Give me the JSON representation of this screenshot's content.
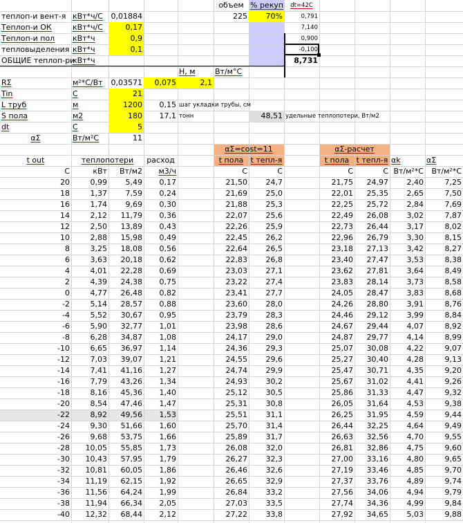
{
  "colors": {
    "yellow": "#ffff00",
    "lavender": "#ccccff",
    "orange": "#f4b183",
    "rowHighlight": "#e6e6e6",
    "gridline": "#d4d4d4",
    "darkLine": "#000000",
    "selection": "#000000"
  },
  "params": [
    {
      "label": "теплоп-и вент-я",
      "unit": "кВт*ч/С",
      "value": "0,01884",
      "value_bg": "none",
      "label_u": false
    },
    {
      "label": "Теплоп-и ОК",
      "unit": "кВт*ч/С",
      "value": "0,17",
      "value_bg": "yellow",
      "label_u": true
    },
    {
      "label": "Теплоп-и пол",
      "unit": "кВт*ч",
      "value": "0,9",
      "value_bg": "yellow",
      "label_u": true
    },
    {
      "label": "тепловыделения",
      "unit": "кВт*ч",
      "value": "0,1",
      "value_bg": "yellow",
      "label_u": false
    },
    {
      "label": "ОБЩИЕ теплоп-ри",
      "unit": "кВт*ч",
      "value": "",
      "value_bg": "none",
      "label_u": false
    }
  ],
  "volume": {
    "header": "объем",
    "value": "225"
  },
  "recup": {
    "header": "% рекуп",
    "value": "70%"
  },
  "dt_col": {
    "header": "dt=42C",
    "values": [
      "0,791",
      "7,140",
      "0,900",
      "-0,100",
      "8,731"
    ]
  },
  "h_header": "Н, м",
  "k_header": "Вт/м°С",
  "rsigma": {
    "label": "RΣ",
    "unit": "м²*С/Вт",
    "value": "0,03571",
    "h": "0,075",
    "k": "2,1"
  },
  "tin": {
    "label": "Tin",
    "unit": "С",
    "value": "21"
  },
  "ltrub": {
    "label": "L труб",
    "unit": "м",
    "value": "1200",
    "step": "0,15",
    "step_label": "шаг укладки трубы, см"
  },
  "spola": {
    "label": "S пола",
    "unit": "м2",
    "value": "180",
    "tons": "17,1",
    "tons_label": "тонн",
    "specific": "48,51",
    "specific_label": "удельные теплопотери, Вт/м2"
  },
  "dt": {
    "label": "dt",
    "unit": "С",
    "value": "5"
  },
  "asigma": {
    "label": "αΣ",
    "unit": "Вт/м²С",
    "value": "11"
  },
  "block1_title": "αΣ=cost=11",
  "block2_title": "αΣ-расчет",
  "headers": {
    "tout": "t out",
    "teplopoteri": "теплопотери",
    "rashod": "расход",
    "tpola": "t пола",
    "ttepl": "t тепл-я",
    "ak": "αk",
    "asig": "αΣ"
  },
  "units": [
    "С",
    "кВт",
    "Вт/м2",
    "м3/ч",
    "С",
    "С",
    "С",
    "С",
    "Вт/м²*С",
    "Вт/м²*С"
  ],
  "highlight_row": 21,
  "rows": [
    [
      "20",
      "0,99",
      "5,49",
      "0,17",
      "21,50",
      "24,7",
      "21,75",
      "24,97",
      "2,40",
      "7,25"
    ],
    [
      "18",
      "1,37",
      "7,59",
      "0,24",
      "21,69",
      "25,0",
      "22,01",
      "25,35",
      "2,65",
      "7,50"
    ],
    [
      "16",
      "1,74",
      "9,69",
      "0,30",
      "21,88",
      "25,3",
      "22,25",
      "25,72",
      "2,84",
      "7,69"
    ],
    [
      "14",
      "2,12",
      "11,79",
      "0,36",
      "22,07",
      "25,6",
      "22,49",
      "26,08",
      "3,02",
      "7,87"
    ],
    [
      "12",
      "2,50",
      "13,89",
      "0,43",
      "22,26",
      "25,9",
      "22,73",
      "26,44",
      "3,17",
      "8,02"
    ],
    [
      "10",
      "2,88",
      "15,98",
      "0,49",
      "22,45",
      "26,2",
      "22,96",
      "26,79",
      "3,30",
      "8,15"
    ],
    [
      "8",
      "3,25",
      "18,08",
      "0,56",
      "22,64",
      "26,5",
      "23,18",
      "27,13",
      "3,42",
      "8,27"
    ],
    [
      "6",
      "3,63",
      "20,18",
      "0,62",
      "22,83",
      "26,8",
      "23,40",
      "27,47",
      "3,53",
      "8,38"
    ],
    [
      "4",
      "4,01",
      "22,28",
      "0,69",
      "23,03",
      "27,1",
      "23,62",
      "27,81",
      "3,64",
      "8,49"
    ],
    [
      "2",
      "4,39",
      "24,38",
      "0,75",
      "23,22",
      "27,4",
      "23,83",
      "28,14",
      "3,73",
      "8,58"
    ],
    [
      "0",
      "4,77",
      "26,48",
      "0,82",
      "23,41",
      "27,7",
      "24,05",
      "28,47",
      "3,83",
      "8,68"
    ],
    [
      "-2",
      "5,14",
      "28,57",
      "0,88",
      "23,60",
      "28,0",
      "24,26",
      "28,80",
      "3,91",
      "8,76"
    ],
    [
      "-4",
      "5,52",
      "30,67",
      "0,95",
      "23,79",
      "28,3",
      "24,46",
      "29,12",
      "3,99",
      "8,84"
    ],
    [
      "-6",
      "5,90",
      "32,77",
      "1,01",
      "23,98",
      "28,6",
      "24,67",
      "29,44",
      "4,07",
      "8,92"
    ],
    [
      "-8",
      "6,28",
      "34,87",
      "1,08",
      "24,17",
      "29,0",
      "24,87",
      "29,77",
      "4,14",
      "8,99"
    ],
    [
      "-10",
      "6,65",
      "36,97",
      "1,14",
      "24,36",
      "29,3",
      "25,07",
      "30,08",
      "4,22",
      "9,07"
    ],
    [
      "-12",
      "7,03",
      "39,07",
      "1,21",
      "24,55",
      "29,6",
      "25,27",
      "30,40",
      "4,28",
      "9,13"
    ],
    [
      "-14",
      "7,41",
      "41,16",
      "1,27",
      "24,74",
      "29,9",
      "25,47",
      "30,71",
      "4,35",
      "9,20"
    ],
    [
      "-16",
      "7,79",
      "43,26",
      "1,34",
      "24,93",
      "30,2",
      "25,67",
      "31,02",
      "4,41",
      "9,26"
    ],
    [
      "-18",
      "8,16",
      "45,36",
      "1,40",
      "25,12",
      "30,5",
      "25,86",
      "31,33",
      "4,47",
      "9,32"
    ],
    [
      "-20",
      "8,54",
      "47,46",
      "1,47",
      "25,31",
      "30,8",
      "26,05",
      "31,64",
      "4,53",
      "9,38"
    ],
    [
      "-22",
      "8,92",
      "49,56",
      "1,53",
      "25,51",
      "31,1",
      "26,25",
      "31,95",
      "4,59",
      "9,44"
    ],
    [
      "-24",
      "9,30",
      "51,66",
      "1,60",
      "25,70",
      "31,4",
      "26,44",
      "32,25",
      "4,64",
      "9,49"
    ],
    [
      "-26",
      "9,68",
      "53,75",
      "1,66",
      "25,89",
      "31,7",
      "26,63",
      "32,56",
      "4,70",
      "9,55"
    ],
    [
      "-28",
      "10,05",
      "55,85",
      "1,73",
      "26,08",
      "32,0",
      "26,81",
      "32,86",
      "4,75",
      "9,60"
    ],
    [
      "-30",
      "10,43",
      "57,95",
      "1,79",
      "26,27",
      "32,3",
      "27,00",
      "33,16",
      "4,80",
      "9,65"
    ],
    [
      "-32",
      "10,81",
      "60,05",
      "1,86",
      "26,46",
      "32,6",
      "27,19",
      "33,46",
      "4,85",
      "9,70"
    ],
    [
      "-34",
      "11,19",
      "62,15",
      "1,92",
      "26,65",
      "32,9",
      "27,37",
      "33,76",
      "4,89",
      "9,74"
    ],
    [
      "-36",
      "11,56",
      "64,24",
      "1,99",
      "26,84",
      "33,2",
      "27,56",
      "34,06",
      "4,94",
      "9,79"
    ],
    [
      "-38",
      "11,94",
      "66,34",
      "2,05",
      "27,03",
      "33,5",
      "27,74",
      "34,36",
      "4,99",
      "9,84"
    ],
    [
      "-40",
      "12,32",
      "68,44",
      "2,12",
      "27,22",
      "33,8",
      "27,92",
      "34,65",
      "5,03",
      "9,88"
    ]
  ]
}
